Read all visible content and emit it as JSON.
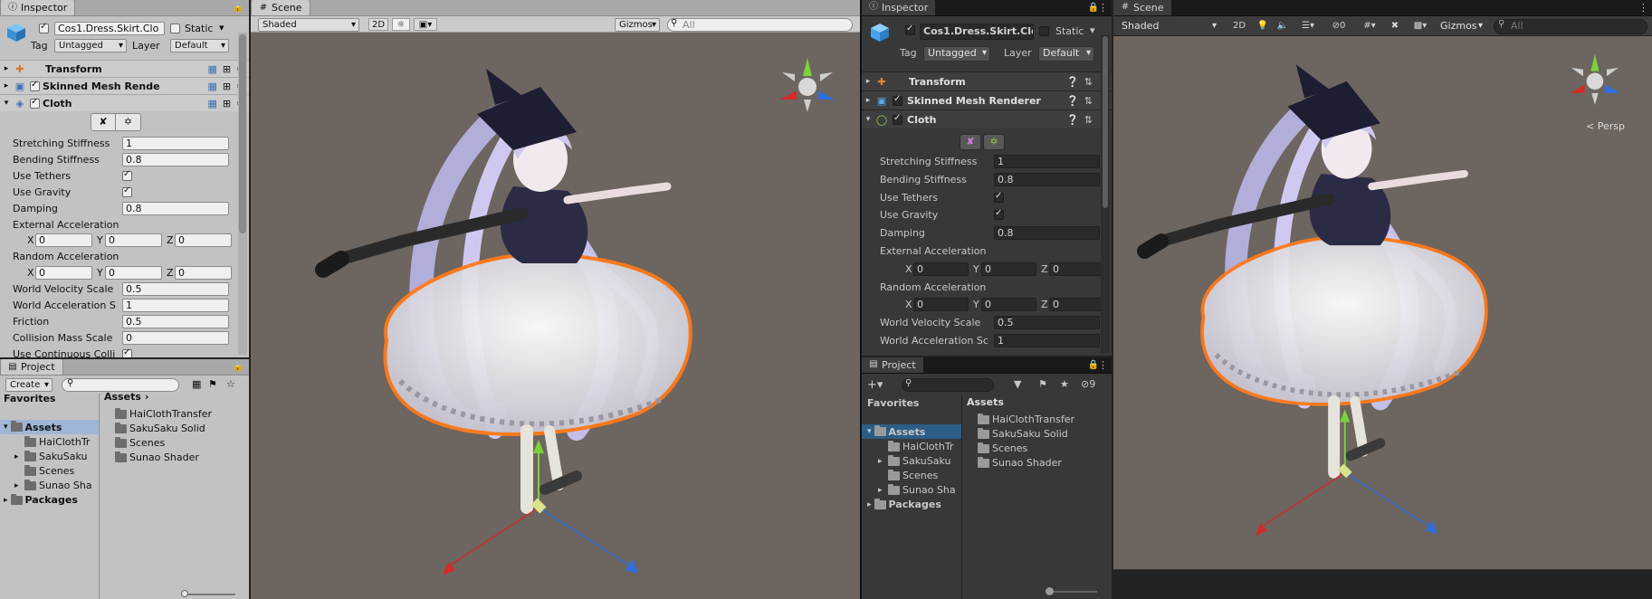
{
  "left": {
    "inspector": {
      "tab": "Inspector",
      "object_name": "Cos1.Dress.Skirt.Clo",
      "static_label": "Static",
      "tag_label": "Tag",
      "tag_value": "Untagged",
      "layer_label": "Layer",
      "layer_value": "Default",
      "components": [
        "Transform",
        "Skinned Mesh Rende",
        "Cloth"
      ],
      "props": [
        {
          "label": "Stretching Stiffness",
          "value": "1"
        },
        {
          "label": "Bending Stiffness",
          "value": "0.8"
        },
        {
          "label": "Use Tethers",
          "value": ""
        },
        {
          "label": "Use Gravity",
          "value": ""
        },
        {
          "label": "Damping",
          "value": "0.8"
        },
        {
          "label": "External Acceleration",
          "value": ""
        },
        {
          "label": "Random Acceleration",
          "value": ""
        },
        {
          "label": "World Velocity Scale",
          "value": "0.5"
        },
        {
          "label": "World Acceleration S",
          "value": "1"
        },
        {
          "label": "Friction",
          "value": "0.5"
        },
        {
          "label": "Collision Mass Scale",
          "value": "0"
        },
        {
          "label": "Use Continuous Colli",
          "value": ""
        }
      ],
      "vec_x": "X",
      "vec_y": "Y",
      "vec_z": "Z",
      "zero": "0"
    },
    "project": {
      "tab": "Project",
      "create": "Create",
      "favorites": "Favorites",
      "assets": "Assets",
      "packages": "Packages",
      "tree_children": [
        "HaiClothTr",
        "SakuSaku",
        "Scenes",
        "Sunao Sha"
      ],
      "assets_header": "Assets",
      "files": [
        "HaiClothTransfer",
        "SakuSaku Solid",
        "Scenes",
        "Sunao Shader"
      ]
    },
    "scene": {
      "tab": "Scene",
      "shading": "Shaded",
      "mode_2d": "2D",
      "gizmos": "Gizmos",
      "search_placeholder": "All"
    }
  },
  "right": {
    "inspector": {
      "tab": "Inspector",
      "object_name": "Cos1.Dress.Skirt.Clo",
      "static_label": "Static",
      "tag_label": "Tag",
      "tag_value": "Untagged",
      "layer_label": "Layer",
      "layer_value": "Default",
      "components": [
        "Transform",
        "Skinned Mesh Renderer",
        "Cloth"
      ],
      "props": [
        {
          "label": "Stretching Stiffness",
          "value": "1"
        },
        {
          "label": "Bending Stiffness",
          "value": "0.8"
        },
        {
          "label": "Use Tethers",
          "value": ""
        },
        {
          "label": "Use Gravity",
          "value": ""
        },
        {
          "label": "Damping",
          "value": "0.8"
        },
        {
          "label": "External Acceleration",
          "value": ""
        },
        {
          "label": "Random Acceleration",
          "value": ""
        },
        {
          "label": "World Velocity Scale",
          "value": "0.5"
        },
        {
          "label": "World Acceleration Sc",
          "value": "1"
        }
      ],
      "vec_x": "X",
      "vec_y": "Y",
      "vec_z": "Z",
      "zero": "0"
    },
    "project": {
      "tab": "Project",
      "favorites": "Favorites",
      "assets": "Assets",
      "packages": "Packages",
      "hidden_count": "9",
      "tree_children": [
        "HaiClothTr",
        "SakuSaku",
        "Scenes",
        "Sunao Sha"
      ],
      "assets_header": "Assets",
      "files": [
        "HaiClothTransfer",
        "SakuSaku Solid",
        "Scenes",
        "Sunao Shader"
      ]
    },
    "scene": {
      "tab": "Scene",
      "shading": "Shaded",
      "mode_2d": "2D",
      "gizmos": "Gizmos",
      "hidden_count": "0",
      "search_placeholder": "All",
      "persp_label": "< Persp"
    }
  },
  "colors": {
    "selection_outline": "#ff7a1a",
    "gizmo_x": "#d12b2b",
    "gizmo_y": "#7bd23a",
    "gizmo_z": "#2f6fe0",
    "scene_bg": "#6a625c"
  }
}
